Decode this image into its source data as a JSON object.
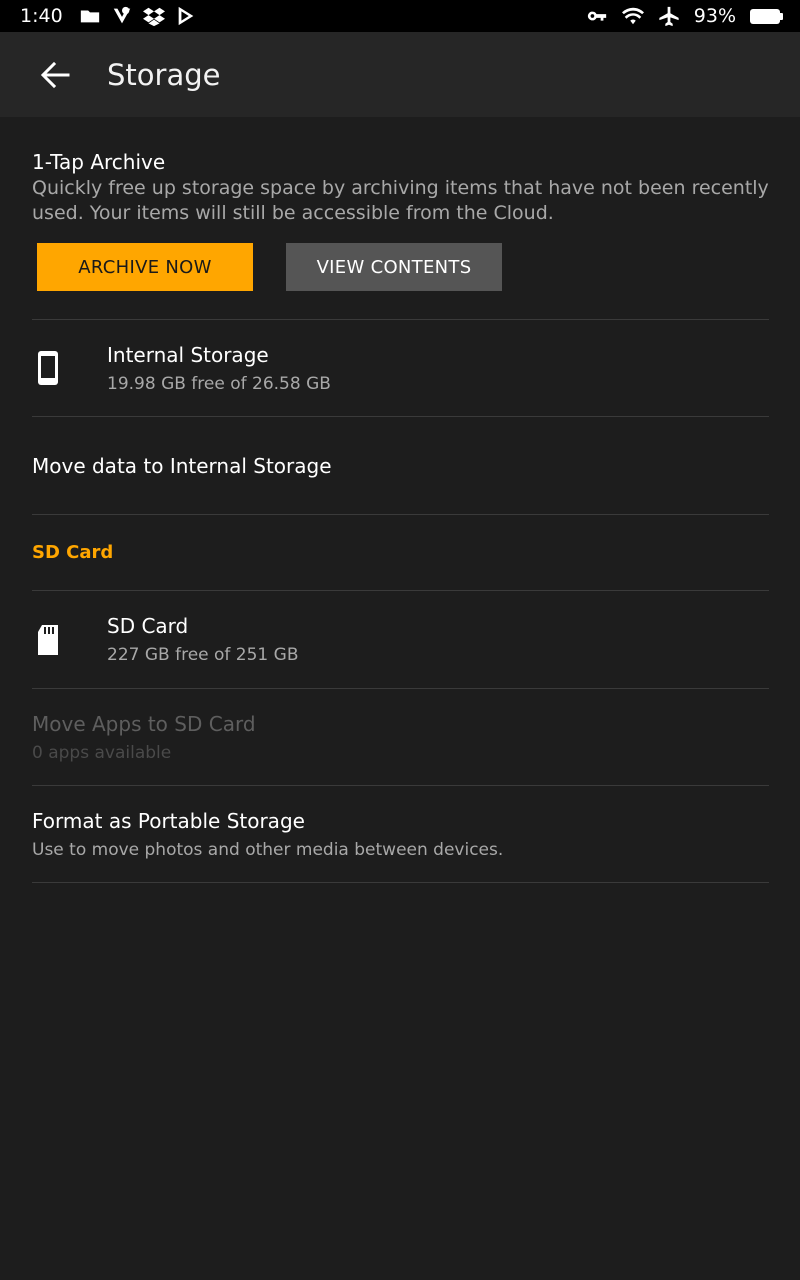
{
  "status_bar": {
    "time": "1:40",
    "battery_percent": "93%",
    "left_icons": [
      "folder-icon",
      "check-shield-icon",
      "dropbox-icon",
      "play-store-icon"
    ],
    "right_icons": [
      "vpn-key-icon",
      "wifi-icon",
      "airplane-icon",
      "battery-icon"
    ]
  },
  "app_bar": {
    "title": "Storage",
    "back_icon": "arrow-left-icon"
  },
  "archive": {
    "heading": "1-Tap Archive",
    "description": "Quickly free up storage space by archiving items that have not been recently used. Your items will still be accessible from the Cloud.",
    "archive_button": "ARCHIVE NOW",
    "view_button": "VIEW CONTENTS"
  },
  "internal_storage": {
    "icon": "phone-icon",
    "title": "Internal Storage",
    "subtitle": "19.98 GB free of 26.58 GB"
  },
  "move_internal": {
    "title": "Move data to Internal Storage"
  },
  "sd_section": {
    "header": "SD Card",
    "card": {
      "icon": "sd-card-icon",
      "title": "SD Card",
      "subtitle": "227 GB free of 251 GB"
    },
    "move_apps": {
      "title": "Move Apps to SD Card",
      "subtitle": "0 apps available"
    },
    "format": {
      "title": "Format as Portable Storage",
      "subtitle": "Use to move photos and other media between devices."
    }
  },
  "colors": {
    "accent": "#ffa600",
    "background": "#1d1d1d",
    "app_bar": "#262626",
    "divider": "#3a3a3a",
    "secondary_button": "#555555"
  }
}
